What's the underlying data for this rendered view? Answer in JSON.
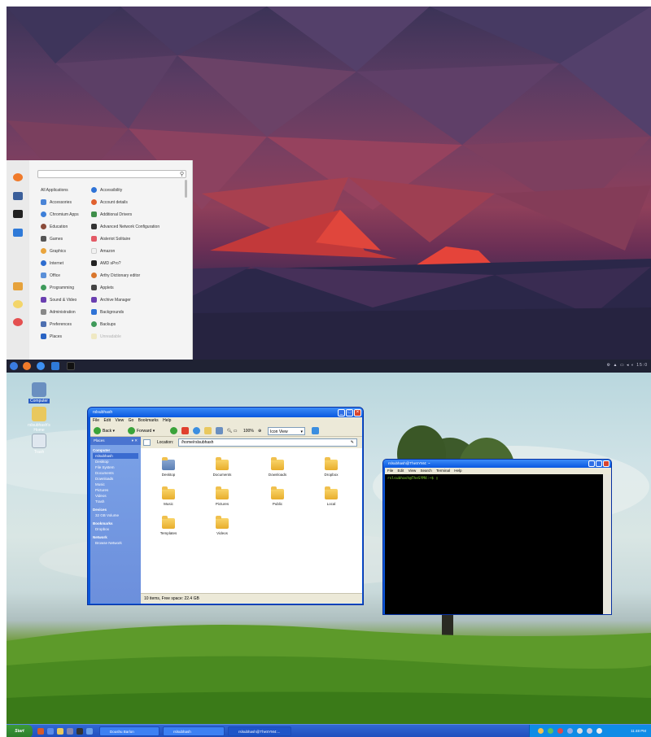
{
  "top_desktop": {
    "start_menu": {
      "search_placeholder": "",
      "left_column": [
        "All Applications",
        "Accessories",
        "Chromium Apps",
        "Education",
        "Games",
        "Graphics",
        "Internet",
        "Office",
        "Programming",
        "Sound & Video",
        "Administration",
        "Preferences",
        "Places"
      ],
      "right_column": [
        "Accessibility",
        "Account details",
        "Additional Drivers",
        "Advanced Network Configuration",
        "Aisleriot Solitaire",
        "Amazon",
        "AMD sPro?",
        "Arthy Dictionary editor",
        "Applets",
        "Archive Manager",
        "Backgrounds",
        "Backups",
        "Unreadable"
      ]
    },
    "taskbar": {
      "tray_text": "⚙ ▲ ▭ ◂ ◐ 15:0"
    }
  },
  "bottom_desktop": {
    "desktop_icons": [
      "Computer",
      "rslsubhash's Home",
      "Trash"
    ],
    "file_manager": {
      "title": "rslsubhash",
      "menu": [
        "File",
        "Edit",
        "View",
        "Go",
        "Bookmarks",
        "Help"
      ],
      "toolbar": {
        "back": "Back",
        "forward": "Forward",
        "zoom": "100%",
        "view_mode": "Icon View"
      },
      "sidebar_header": "Places",
      "sidebar": [
        {
          "label": "Computer",
          "bold": true
        },
        {
          "label": "rslsubhash",
          "bold": false
        },
        {
          "label": "Desktop",
          "bold": false
        },
        {
          "label": "File System",
          "bold": false
        },
        {
          "label": "Documents",
          "bold": false
        },
        {
          "label": "Downloads",
          "bold": false
        },
        {
          "label": "Music",
          "bold": false
        },
        {
          "label": "Pictures",
          "bold": false
        },
        {
          "label": "Videos",
          "bold": false
        },
        {
          "label": "Trash",
          "bold": false
        },
        {
          "label": "Devices",
          "bold": true
        },
        {
          "label": "32 GB Volume",
          "bold": false
        },
        {
          "label": "Bookmarks",
          "bold": true
        },
        {
          "label": "Dropbox",
          "bold": false
        },
        {
          "label": "Network",
          "bold": true
        },
        {
          "label": "Browse Network",
          "bold": false
        }
      ],
      "location_label": "Location:",
      "location_value": "/home/rslsubhash",
      "folders": [
        "Desktop",
        "Documents",
        "Downloads",
        "Dropbox",
        "Music",
        "Pictures",
        "Public",
        "Local",
        "Templates",
        "Videos"
      ],
      "status": "10 items, Free space: 22.4 GB"
    },
    "terminal": {
      "title": "rslsubhash@TheSYM4: ~",
      "menu": [
        "File",
        "Edit",
        "View",
        "Search",
        "Terminal",
        "Help"
      ],
      "prompt": "rslsubhash@TheSYM4:~$ ▯"
    },
    "taskbar": {
      "start_label": "Start",
      "tasks": [
        "Doushu Barlon",
        "rslsubhash",
        "rslsubhash@TheSYM4:..."
      ],
      "clock": "11:48 PM"
    }
  }
}
